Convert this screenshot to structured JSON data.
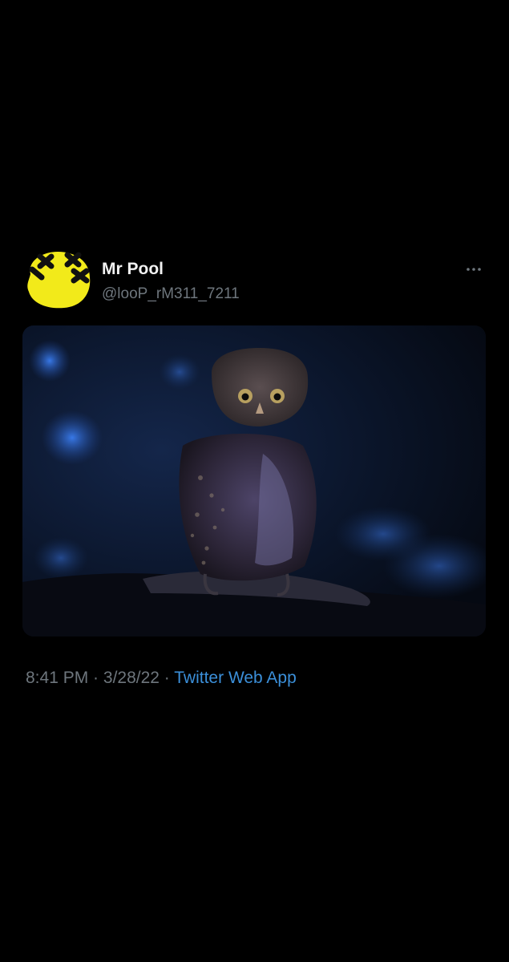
{
  "tweet": {
    "author": {
      "name": "Mr Pool",
      "handle": "@looP_rM311_7211",
      "avatar_icon": "yellow-blob-with-black-x-marks-icon"
    },
    "media": {
      "kind": "photo",
      "subject": "owl-image"
    },
    "meta": {
      "time": "8:41 PM",
      "separator1": " · ",
      "date": "3/28/22",
      "separator2": " · ",
      "source": "Twitter Web App"
    },
    "more_icon": "more-horizontal-icon"
  },
  "colors": {
    "background": "#000000",
    "name_text": "#f2f2f2",
    "secondary_text": "#6e767d",
    "link": "#3b8fd9",
    "avatar_yellow": "#f2ea1a"
  }
}
